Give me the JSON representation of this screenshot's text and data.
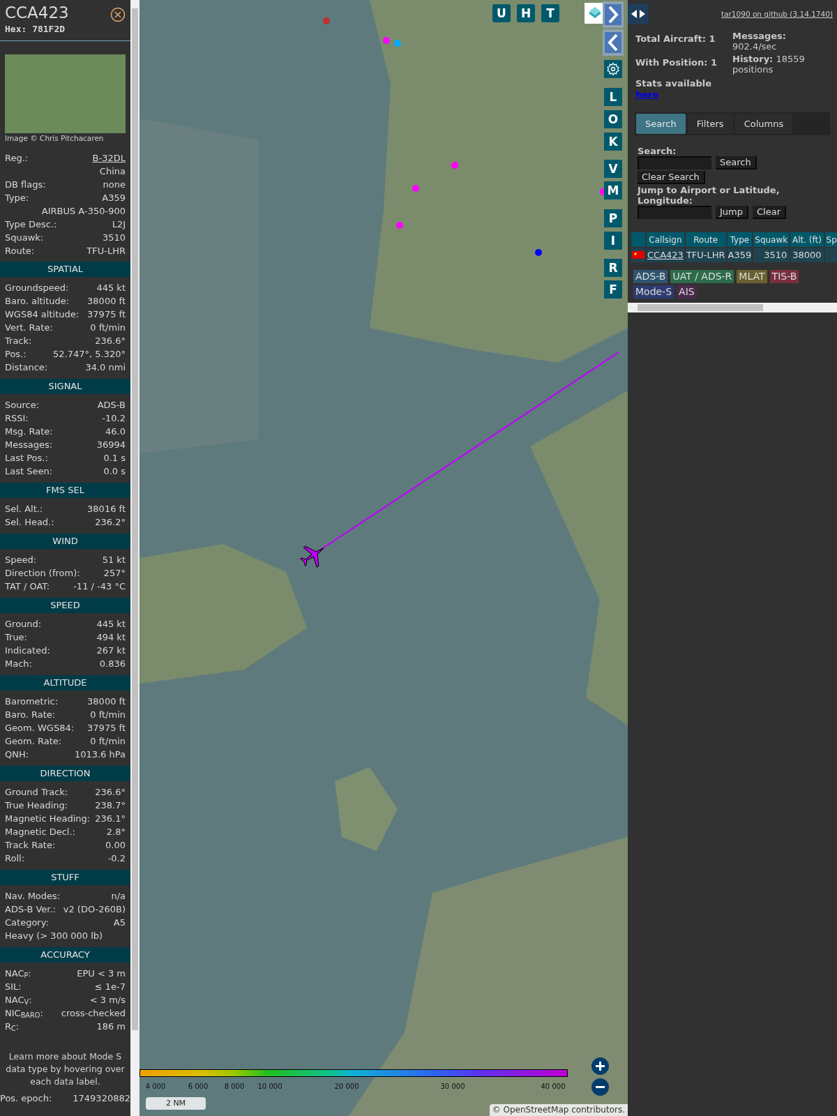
{
  "sidebar": {
    "callsign": "CCA423",
    "hex": "Hex: 781F2D",
    "photo_credit": "Image © Chris Pitchacaren",
    "info": [
      {
        "kind": "link",
        "label": "Reg.:",
        "value": "B-32DL"
      },
      {
        "kind": "text",
        "value": "China"
      },
      {
        "kind": "text",
        "label": "DB flags:",
        "value": "none"
      },
      {
        "kind": "text",
        "label": "Type:",
        "value": "A359"
      },
      {
        "kind": "text",
        "value": "AIRBUS A-350-900"
      },
      {
        "kind": "text",
        "label": "Type Desc.:",
        "value": "L2J"
      },
      {
        "kind": "text",
        "label": "Squawk:",
        "value": "3510"
      },
      {
        "kind": "text",
        "label": "Route:",
        "value": "TFU-LHR"
      }
    ],
    "sections": [
      {
        "title": "SPATIAL",
        "rows": [
          {
            "label": "Groundspeed:",
            "value": "445 kt"
          },
          {
            "label": "Baro. altitude:",
            "value": "38000 ft"
          },
          {
            "label": "WGS84 altitude:",
            "value": "37975 ft"
          },
          {
            "label": "Vert. Rate:",
            "value": "0 ft/min"
          },
          {
            "label": "Track:",
            "value": "236.6°"
          },
          {
            "label": "Pos.:",
            "value": "52.747°, 5.320°"
          },
          {
            "label": "Distance:",
            "value": "34.0 nmi"
          }
        ]
      },
      {
        "title": "SIGNAL",
        "rows": [
          {
            "label": "Source:",
            "value": "ADS-B"
          },
          {
            "label": "RSSI:",
            "value": "-10.2"
          },
          {
            "label": "Msg. Rate:",
            "value": "46.0"
          },
          {
            "label": "Messages:",
            "value": "36994"
          },
          {
            "label": "Last Pos.:",
            "value": "0.1 s"
          },
          {
            "label": "Last Seen:",
            "value": "0.0 s"
          }
        ]
      },
      {
        "title": "FMS SEL",
        "rows": [
          {
            "label": "Sel. Alt.:",
            "value": "38016 ft"
          },
          {
            "label": "Sel. Head.:",
            "value": "236.2°"
          }
        ]
      },
      {
        "title": "WIND",
        "rows": [
          {
            "label": "Speed:",
            "value": "51 kt"
          },
          {
            "label": "Direction (from):",
            "value": "257°"
          },
          {
            "label": "TAT / OAT:",
            "value": "-11 / -43 °C"
          }
        ]
      },
      {
        "title": "SPEED",
        "rows": [
          {
            "label": "Ground:",
            "value": "445 kt"
          },
          {
            "label": "True:",
            "value": "494 kt"
          },
          {
            "label": "Indicated:",
            "value": "267 kt"
          },
          {
            "label": "Mach:",
            "value": "0.836"
          }
        ]
      },
      {
        "title": "ALTITUDE",
        "rows": [
          {
            "label": "Barometric:",
            "value": "38000 ft"
          },
          {
            "label": "Baro. Rate:",
            "value": "0 ft/min"
          },
          {
            "label": "Geom. WGS84:",
            "value": "37975 ft"
          },
          {
            "label": "Geom. Rate:",
            "value": "0 ft/min"
          },
          {
            "label": "QNH:",
            "value": "1013.6 hPa"
          }
        ]
      },
      {
        "title": "DIRECTION",
        "rows": [
          {
            "label": "Ground Track:",
            "value": "236.6°"
          },
          {
            "label": "True Heading:",
            "value": "238.7°"
          },
          {
            "label": "Magnetic Heading:",
            "value": "236.1°"
          },
          {
            "label": "Magnetic Decl.:",
            "value": "2.8°"
          },
          {
            "label": "Track Rate:",
            "value": "0.00"
          },
          {
            "label": "Roll:",
            "value": "-0.2"
          }
        ]
      },
      {
        "title": "STUFF",
        "rows": [
          {
            "label": "Nav. Modes:",
            "value": "n/a"
          },
          {
            "label": "ADS-B Ver.:",
            "value": "v2 (DO-260B)"
          },
          {
            "label": "Category:",
            "value": "A5"
          },
          {
            "label": "Heavy (> 300 000 lb)"
          }
        ]
      },
      {
        "title": "ACCURACY",
        "rows": [
          {
            "label": "NAC$_{P}$:",
            "value": "EPU < 3 m"
          },
          {
            "label": "SIL:",
            "value": "≤ 1e-7"
          },
          {
            "label": "NAC$_{V}$:",
            "value": "< 3 m/s"
          },
          {
            "label": "NIC$_{BARO}$:",
            "value": "cross-checked"
          },
          {
            "label": "R$_{C}$:",
            "value": "186 m"
          }
        ]
      }
    ],
    "footnote": "Learn more about Mode S data type by hovering over each data label.",
    "epoch": {
      "label": "Pos. epoch:",
      "value": "1749320882"
    }
  },
  "map": {
    "top_buttons": [
      "U",
      "H",
      "T"
    ],
    "side_buttons": [
      "L",
      "O",
      "K",
      "V",
      "M",
      "P",
      "I",
      "R",
      "F"
    ],
    "legend_ticks": [
      "4 000",
      "6 000",
      "8 000",
      "10 000",
      "20 000",
      "30 000",
      "40 000"
    ],
    "scale": "2 NM",
    "attribution": "© OpenStreetMap contributors."
  },
  "panel": {
    "github_link": "tar1090 on github (3.14.1740)",
    "stats_left": [
      "Total Aircraft: 1",
      "With Position: 1"
    ],
    "stats_link_text": "Stats available",
    "stats_link": "here",
    "stats_right": [
      "**Messages:** 902.4/sec",
      "**History:** 18559 positions"
    ],
    "tabs": [
      {
        "label": "Search",
        "selected": true
      },
      {
        "label": "Filters",
        "selected": false
      },
      {
        "label": "Columns",
        "selected": false
      }
    ],
    "search_label": "Search:",
    "search_button": "Search",
    "clear_search_button": "Clear Search",
    "jump_label": "Jump to Airport or Latitude, Longitude:",
    "jump_button": "Jump",
    "clear_button": "Clear",
    "table": {
      "columns": [
        "Callsign",
        "Route",
        "Type",
        "Squawk",
        "Alt. (ft)",
        "Sp"
      ],
      "rows": [
        {
          "callsign": "CCA423",
          "route": "TFU-LHR",
          "type": "A359",
          "squawk": "3510",
          "altitude": "38000"
        }
      ]
    },
    "sources": [
      {
        "label": "ADS-B",
        "color": "#2e5470"
      },
      {
        "label": "UAT / ADS-R",
        "color": "#2d6b4a"
      },
      {
        "label": "MLAT",
        "color": "#6b6030"
      },
      {
        "label": "TIS-B",
        "color": "#7a2f40"
      },
      {
        "label": "Mode-S",
        "color": "#2e3a70"
      },
      {
        "label": "AIS",
        "color": "#4a2a4a"
      }
    ]
  }
}
